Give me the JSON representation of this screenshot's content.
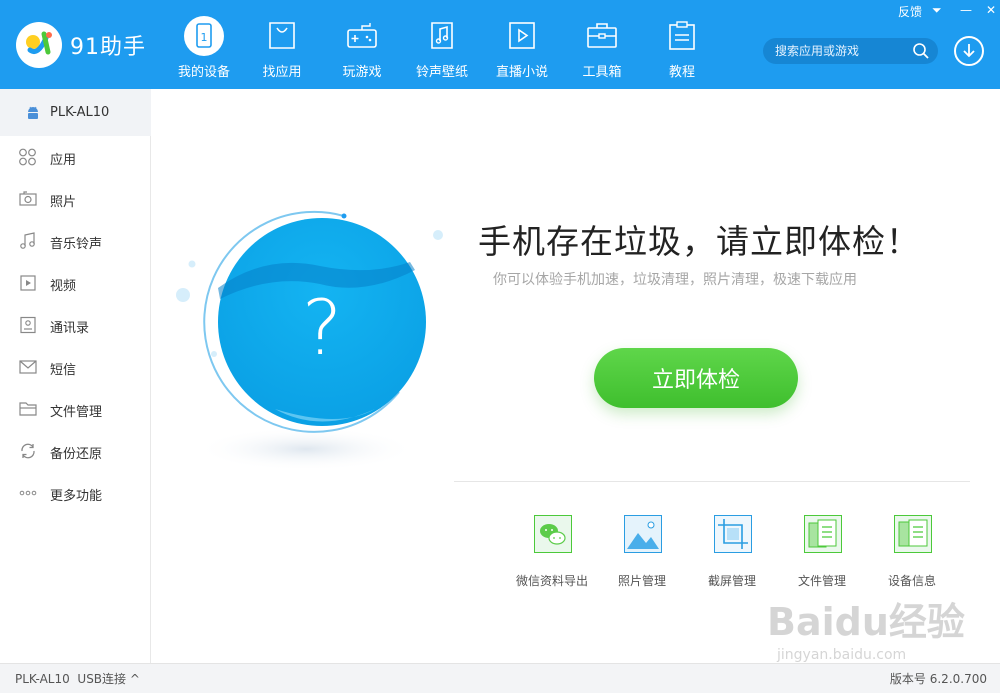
{
  "app": {
    "title": "91助手"
  },
  "window": {
    "feedback": "反馈",
    "menu_glyph": "⏷",
    "minimize_glyph": "—",
    "close_glyph": "✕"
  },
  "nav": [
    {
      "label": "我的设备",
      "icon": "phone-icon",
      "active": true
    },
    {
      "label": "找应用",
      "icon": "shopping-bag-icon"
    },
    {
      "label": "玩游戏",
      "icon": "gamepad-icon"
    },
    {
      "label": "铃声壁纸",
      "icon": "music-note-icon"
    },
    {
      "label": "直播小说",
      "icon": "play-icon"
    },
    {
      "label": "工具箱",
      "icon": "toolbox-icon"
    },
    {
      "label": "教程",
      "icon": "clipboard-icon"
    }
  ],
  "search": {
    "placeholder": "搜索应用或游戏"
  },
  "sidebar": {
    "device_name": "PLK-AL10",
    "items": [
      {
        "label": "应用",
        "icon": "apps-grid-icon"
      },
      {
        "label": "照片",
        "icon": "camera-icon"
      },
      {
        "label": "音乐铃声",
        "icon": "music-icon"
      },
      {
        "label": "视频",
        "icon": "video-icon"
      },
      {
        "label": "通讯录",
        "icon": "contacts-icon"
      },
      {
        "label": "短信",
        "icon": "envelope-icon"
      },
      {
        "label": "文件管理",
        "icon": "folder-icon"
      },
      {
        "label": "备份还原",
        "icon": "sync-icon"
      },
      {
        "label": "更多功能",
        "icon": "more-icon"
      }
    ]
  },
  "main": {
    "headline": "手机存在垃圾，请立即体检！",
    "subline": "你可以体验手机加速，垃圾清理，照片清理，极速下载应用",
    "check_button": "立即体检",
    "question_mark": "?",
    "tools": [
      {
        "label": "微信资料导出",
        "icon": "wechat-icon"
      },
      {
        "label": "照片管理",
        "icon": "photo-icon"
      },
      {
        "label": "截屏管理",
        "icon": "screenshot-icon"
      },
      {
        "label": "文件管理",
        "icon": "file-manager-icon"
      },
      {
        "label": "设备信息",
        "icon": "device-info-icon"
      }
    ]
  },
  "statusbar": {
    "device": "PLK-AL10",
    "connection": "USB连接 ^",
    "version_label": "版本号",
    "version": "6.2.0.700"
  },
  "watermark": {
    "text": "Baidu经验",
    "url": "jingyan.baidu.com"
  },
  "colors": {
    "header": "#1e9cf0",
    "accent_green": "#4cc93a",
    "water": "#0aa8ea"
  }
}
